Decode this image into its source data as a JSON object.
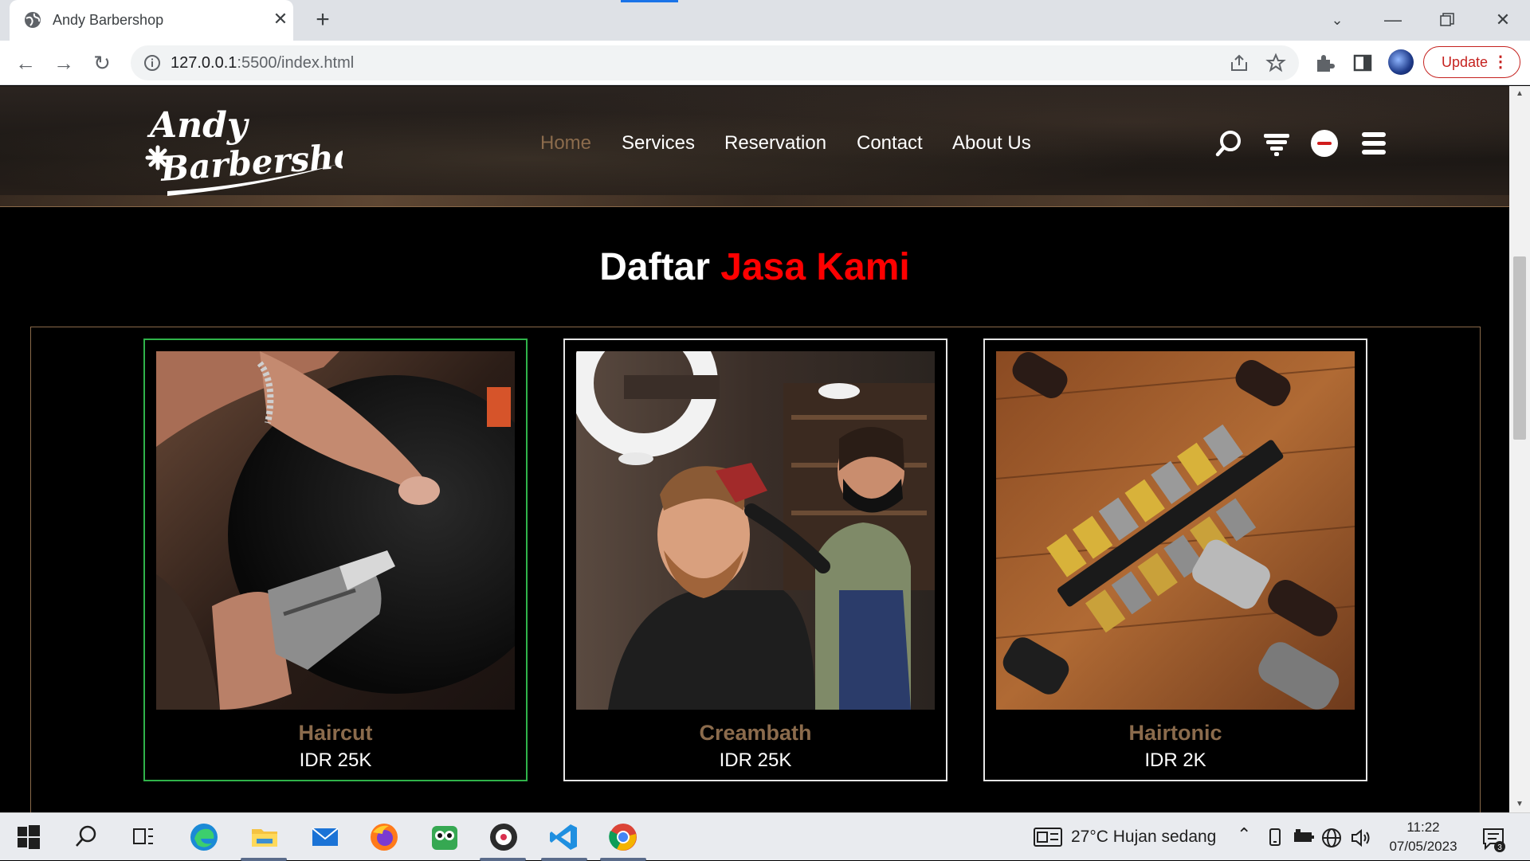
{
  "browser": {
    "tab_title": "Andy Barbershop",
    "url_host": "127.0.0.1",
    "url_path": ":5500/index.html",
    "update_label": "Update",
    "accent": "#1a73e8"
  },
  "site": {
    "logo_line1": "Andy",
    "logo_line2": "Barbershop",
    "nav": [
      {
        "label": "Home",
        "active": true
      },
      {
        "label": "Services"
      },
      {
        "label": "Reservation"
      },
      {
        "label": "Contact"
      },
      {
        "label": "About Us"
      }
    ],
    "header_icons": [
      "search-icon",
      "filter-icon",
      "badge-icon",
      "menu-icon"
    ],
    "section_title_plain": "Daftar",
    "section_title_accent": "Jasa Kami",
    "colors": {
      "accent_red": "#ff0000",
      "brown": "#8b6b4c",
      "selected_border": "#2fb34a"
    },
    "services": [
      {
        "name": "Haircut",
        "price": "IDR 25K",
        "image": "haircut-photo"
      },
      {
        "name": "Creambath",
        "price": "IDR 25K",
        "image": "creambath-photo"
      },
      {
        "name": "Hairtonic",
        "price": "IDR 2K",
        "image": "clippers-photo"
      }
    ]
  },
  "taskbar": {
    "weather": "27°C  Hujan sedang",
    "time": "11:22",
    "date": "07/05/2023",
    "notifications": "3"
  }
}
